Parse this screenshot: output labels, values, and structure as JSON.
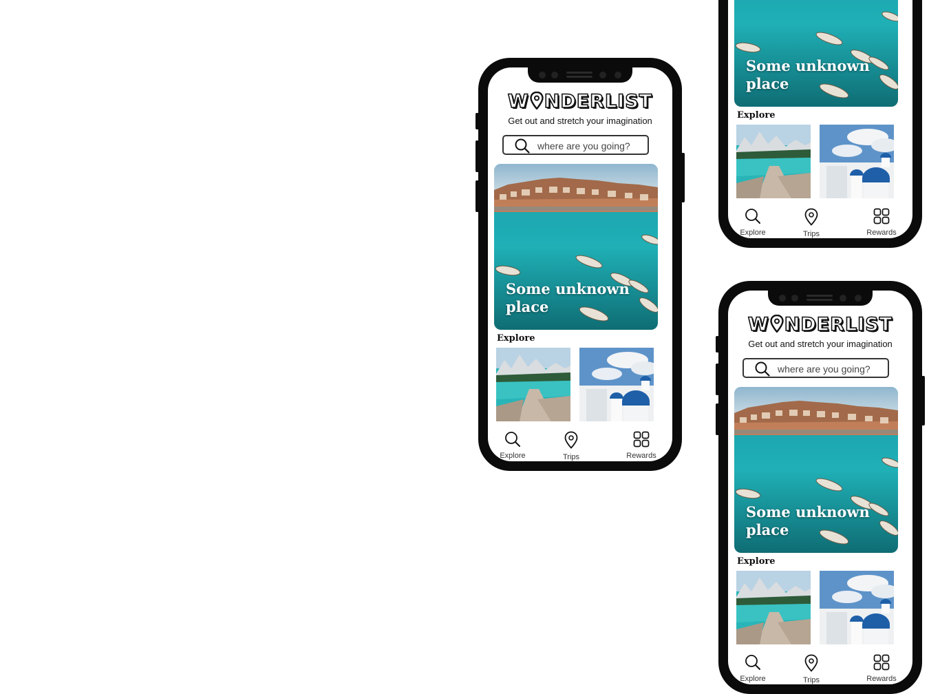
{
  "app": {
    "logo_text": "W NDERLIST",
    "tagline": "Get out and stretch your imagination"
  },
  "search": {
    "placeholder": "where are you going?"
  },
  "hero": {
    "title": "Some unknown place"
  },
  "explore": {
    "heading": "Explore",
    "items": [
      {
        "name": "mountain-lake-thumb"
      },
      {
        "name": "santorini-thumb"
      }
    ]
  },
  "nav": {
    "items": [
      {
        "label": "Explore",
        "icon": "search-icon"
      },
      {
        "label": "Trips",
        "icon": "pin-icon"
      },
      {
        "label": "Rewards",
        "icon": "grid-icon"
      }
    ]
  },
  "colors": {
    "phone_frame": "#0b0b0b",
    "text": "#111111",
    "sea": "#1fa7b0"
  }
}
